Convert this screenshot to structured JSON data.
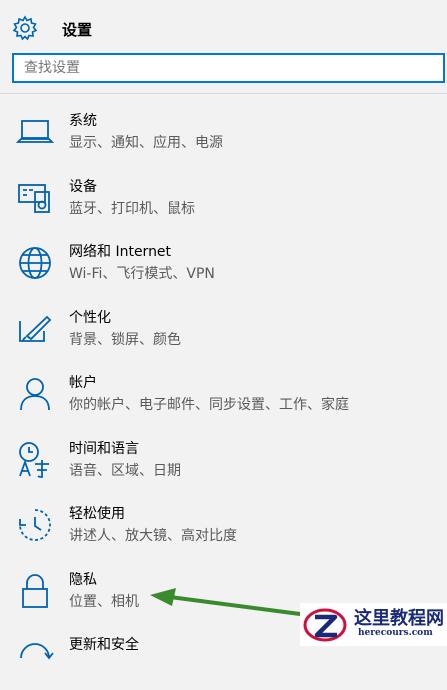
{
  "header": {
    "title": "设置",
    "icon": "gear-icon"
  },
  "search": {
    "placeholder": "查找设置"
  },
  "items": [
    {
      "name": "系统",
      "desc": "显示、通知、应用、电源",
      "icon": "laptop-icon"
    },
    {
      "name": "设备",
      "desc": "蓝牙、打印机、鼠标",
      "icon": "devices-icon"
    },
    {
      "name": "网络和 Internet",
      "desc": "Wi-Fi、飞行模式、VPN",
      "icon": "globe-icon"
    },
    {
      "name": "个性化",
      "desc": "背景、锁屏、颜色",
      "icon": "paint-brush-icon"
    },
    {
      "name": "帐户",
      "desc": "你的帐户、电子邮件、同步设置、工作、家庭",
      "icon": "person-icon"
    },
    {
      "name": "时间和语言",
      "desc": "语音、区域、日期",
      "icon": "time-language-icon"
    },
    {
      "name": "轻松使用",
      "desc": "讲述人、放大镜、高对比度",
      "icon": "ease-of-access-icon"
    },
    {
      "name": "隐私",
      "desc": "位置、相机",
      "icon": "lock-icon"
    },
    {
      "name": "更新和安全",
      "desc": "",
      "icon": "update-icon"
    }
  ],
  "watermark": {
    "title": "这里教程网",
    "url": "herecours.com"
  },
  "colors": {
    "accent": "#0078d7",
    "arrow": "#3a8a2e",
    "watermark": "#1a2a78"
  }
}
